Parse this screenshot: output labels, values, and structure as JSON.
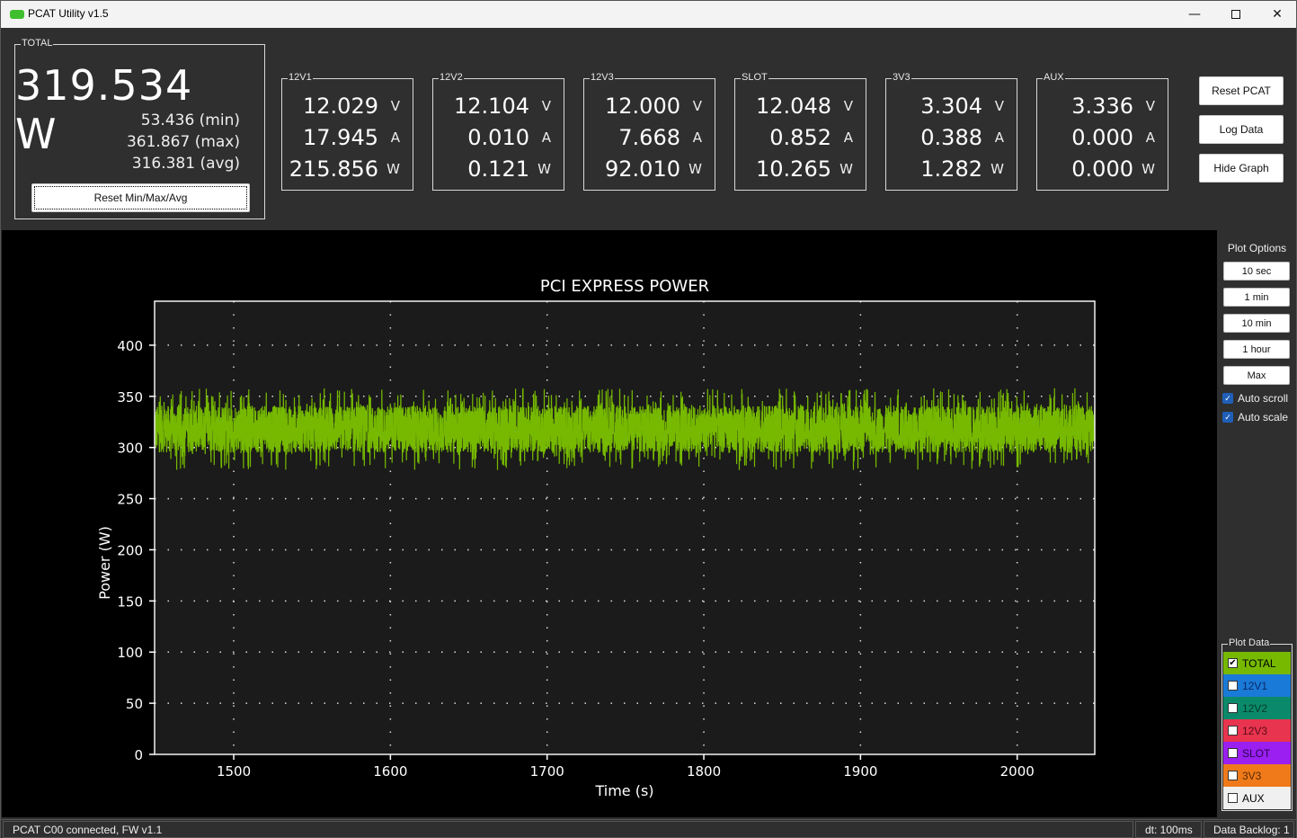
{
  "window": {
    "title": "PCAT Utility v1.5",
    "controls": [
      "minimize",
      "maximize",
      "close"
    ]
  },
  "total": {
    "legend": "TOTAL",
    "power": "319.534 W",
    "min": "53.436 (min)",
    "max": "361.867 (max)",
    "avg": "316.381 (avg)",
    "reset_label": "Reset Min/Max/Avg"
  },
  "rails": [
    {
      "name": "12V1",
      "voltage": "12.029",
      "current": "17.945",
      "power": "215.856"
    },
    {
      "name": "12V2",
      "voltage": "12.104",
      "current": "0.010",
      "power": "0.121"
    },
    {
      "name": "12V3",
      "voltage": "12.000",
      "current": "7.668",
      "power": "92.010"
    },
    {
      "name": "SLOT",
      "voltage": "12.048",
      "current": "0.852",
      "power": "10.265"
    },
    {
      "name": "3V3",
      "voltage": "3.304",
      "current": "0.388",
      "power": "1.282"
    },
    {
      "name": "AUX",
      "voltage": "3.336",
      "current": "0.000",
      "power": "0.000"
    }
  ],
  "units": {
    "v": "V",
    "a": "A",
    "w": "W"
  },
  "actions": {
    "reset_pcat": "Reset PCAT",
    "log_data": "Log Data",
    "hide_graph": "Hide Graph"
  },
  "plot_options": {
    "title": "Plot Options",
    "buttons": [
      "10 sec",
      "1 min",
      "10 min",
      "1 hour",
      "Max"
    ],
    "auto_scroll": {
      "label": "Auto scroll",
      "checked": true
    },
    "auto_scale": {
      "label": "Auto scale",
      "checked": true
    }
  },
  "plot_data": {
    "title": "Plot Data",
    "items": [
      {
        "label": "TOTAL",
        "checked": true,
        "color": "#76b900",
        "text": "#000000"
      },
      {
        "label": "12V1",
        "checked": false,
        "color": "#1a7ad8",
        "text": "#0a2a66"
      },
      {
        "label": "12V2",
        "checked": false,
        "color": "#0a8a6a",
        "text": "#053a2a"
      },
      {
        "label": "12V3",
        "checked": false,
        "color": "#e8344e",
        "text": "#5a0a18"
      },
      {
        "label": "SLOT",
        "checked": false,
        "color": "#9a1ff0",
        "text": "#2a0650"
      },
      {
        "label": "3V3",
        "checked": false,
        "color": "#f07a1a",
        "text": "#5a2a05"
      },
      {
        "label": "AUX",
        "checked": false,
        "color": "#f0f0f0",
        "text": "#000000"
      }
    ]
  },
  "status": {
    "connection": "PCAT C00 connected, FW v1.1",
    "dt": "dt: 100ms",
    "backlog": "Data Backlog: 1"
  },
  "chart_data": {
    "type": "line",
    "title": "PCI EXPRESS POWER",
    "xlabel": "Time (s)",
    "ylabel": "Power (W)",
    "xlim": [
      1449.5,
      2049.5
    ],
    "ylim": [
      0,
      443
    ],
    "xticks": [
      1500,
      1600,
      1700,
      1800,
      1900,
      2000
    ],
    "yticks": [
      0,
      50,
      100,
      150,
      200,
      250,
      300,
      350,
      400
    ],
    "grid": true,
    "series": [
      {
        "name": "TOTAL",
        "color": "#76b900",
        "mean": 318,
        "min_approx": 278,
        "max_approx": 360,
        "sample_interval_s": 0.1
      }
    ]
  }
}
